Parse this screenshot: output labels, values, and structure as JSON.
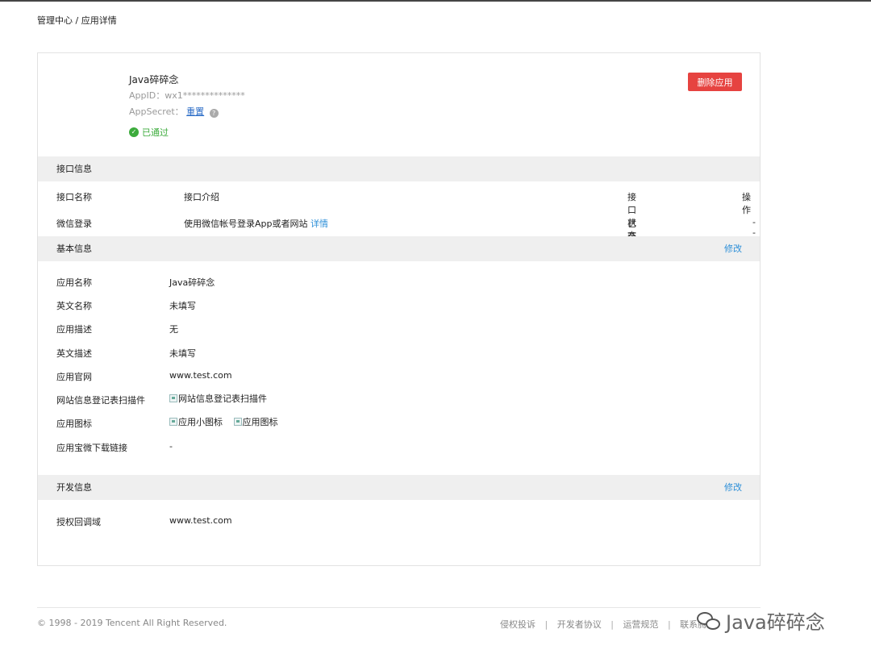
{
  "breadcrumb": "管理中心 / 应用详情",
  "app": {
    "name": "Java碎碎念",
    "appid_label": "AppID：wx1**************",
    "appsecret_label": "AppSecret：",
    "appsecret_action": "重置",
    "help_glyph": "?",
    "status": "已通过",
    "status_icon": "check-circle",
    "delete_button": "删除应用"
  },
  "api_section": {
    "title": "接口信息",
    "headers": [
      "接口名称",
      "接口介绍",
      "接口状态",
      "操作"
    ],
    "rows": [
      {
        "name": "微信登录",
        "desc": "使用微信帐号登录App或者网站",
        "detail_link": "详情",
        "status": "已获得",
        "action": "--"
      }
    ]
  },
  "basic_section": {
    "title": "基本信息",
    "edit": "修改",
    "fields": [
      {
        "label": "应用名称",
        "value": "Java碎碎念"
      },
      {
        "label": "英文名称",
        "value": "未填写"
      },
      {
        "label": "应用描述",
        "value": "无"
      },
      {
        "label": "英文描述",
        "value": "未填写"
      },
      {
        "label": "应用官网",
        "value": "www.test.com"
      },
      {
        "label": "网站信息登记表扫描件",
        "image_alt": "网站信息登记表扫描件"
      },
      {
        "label": "应用图标",
        "image_alt_small": "应用小图标",
        "image_alt_large": "应用图标"
      },
      {
        "label": "应用宝微下载链接",
        "value": "-"
      }
    ]
  },
  "dev_section": {
    "title": "开发信息",
    "edit": "修改",
    "fields": [
      {
        "label": "授权回调域",
        "value": "www.test.com"
      }
    ]
  },
  "footer": {
    "copyright": "© 1998 - 2019 Tencent All Right Reserved.",
    "links": [
      "侵权投诉",
      "开发者协议",
      "运营规范",
      "联系腾讯"
    ],
    "separator": "|"
  },
  "watermark": "Java碎碎念"
}
